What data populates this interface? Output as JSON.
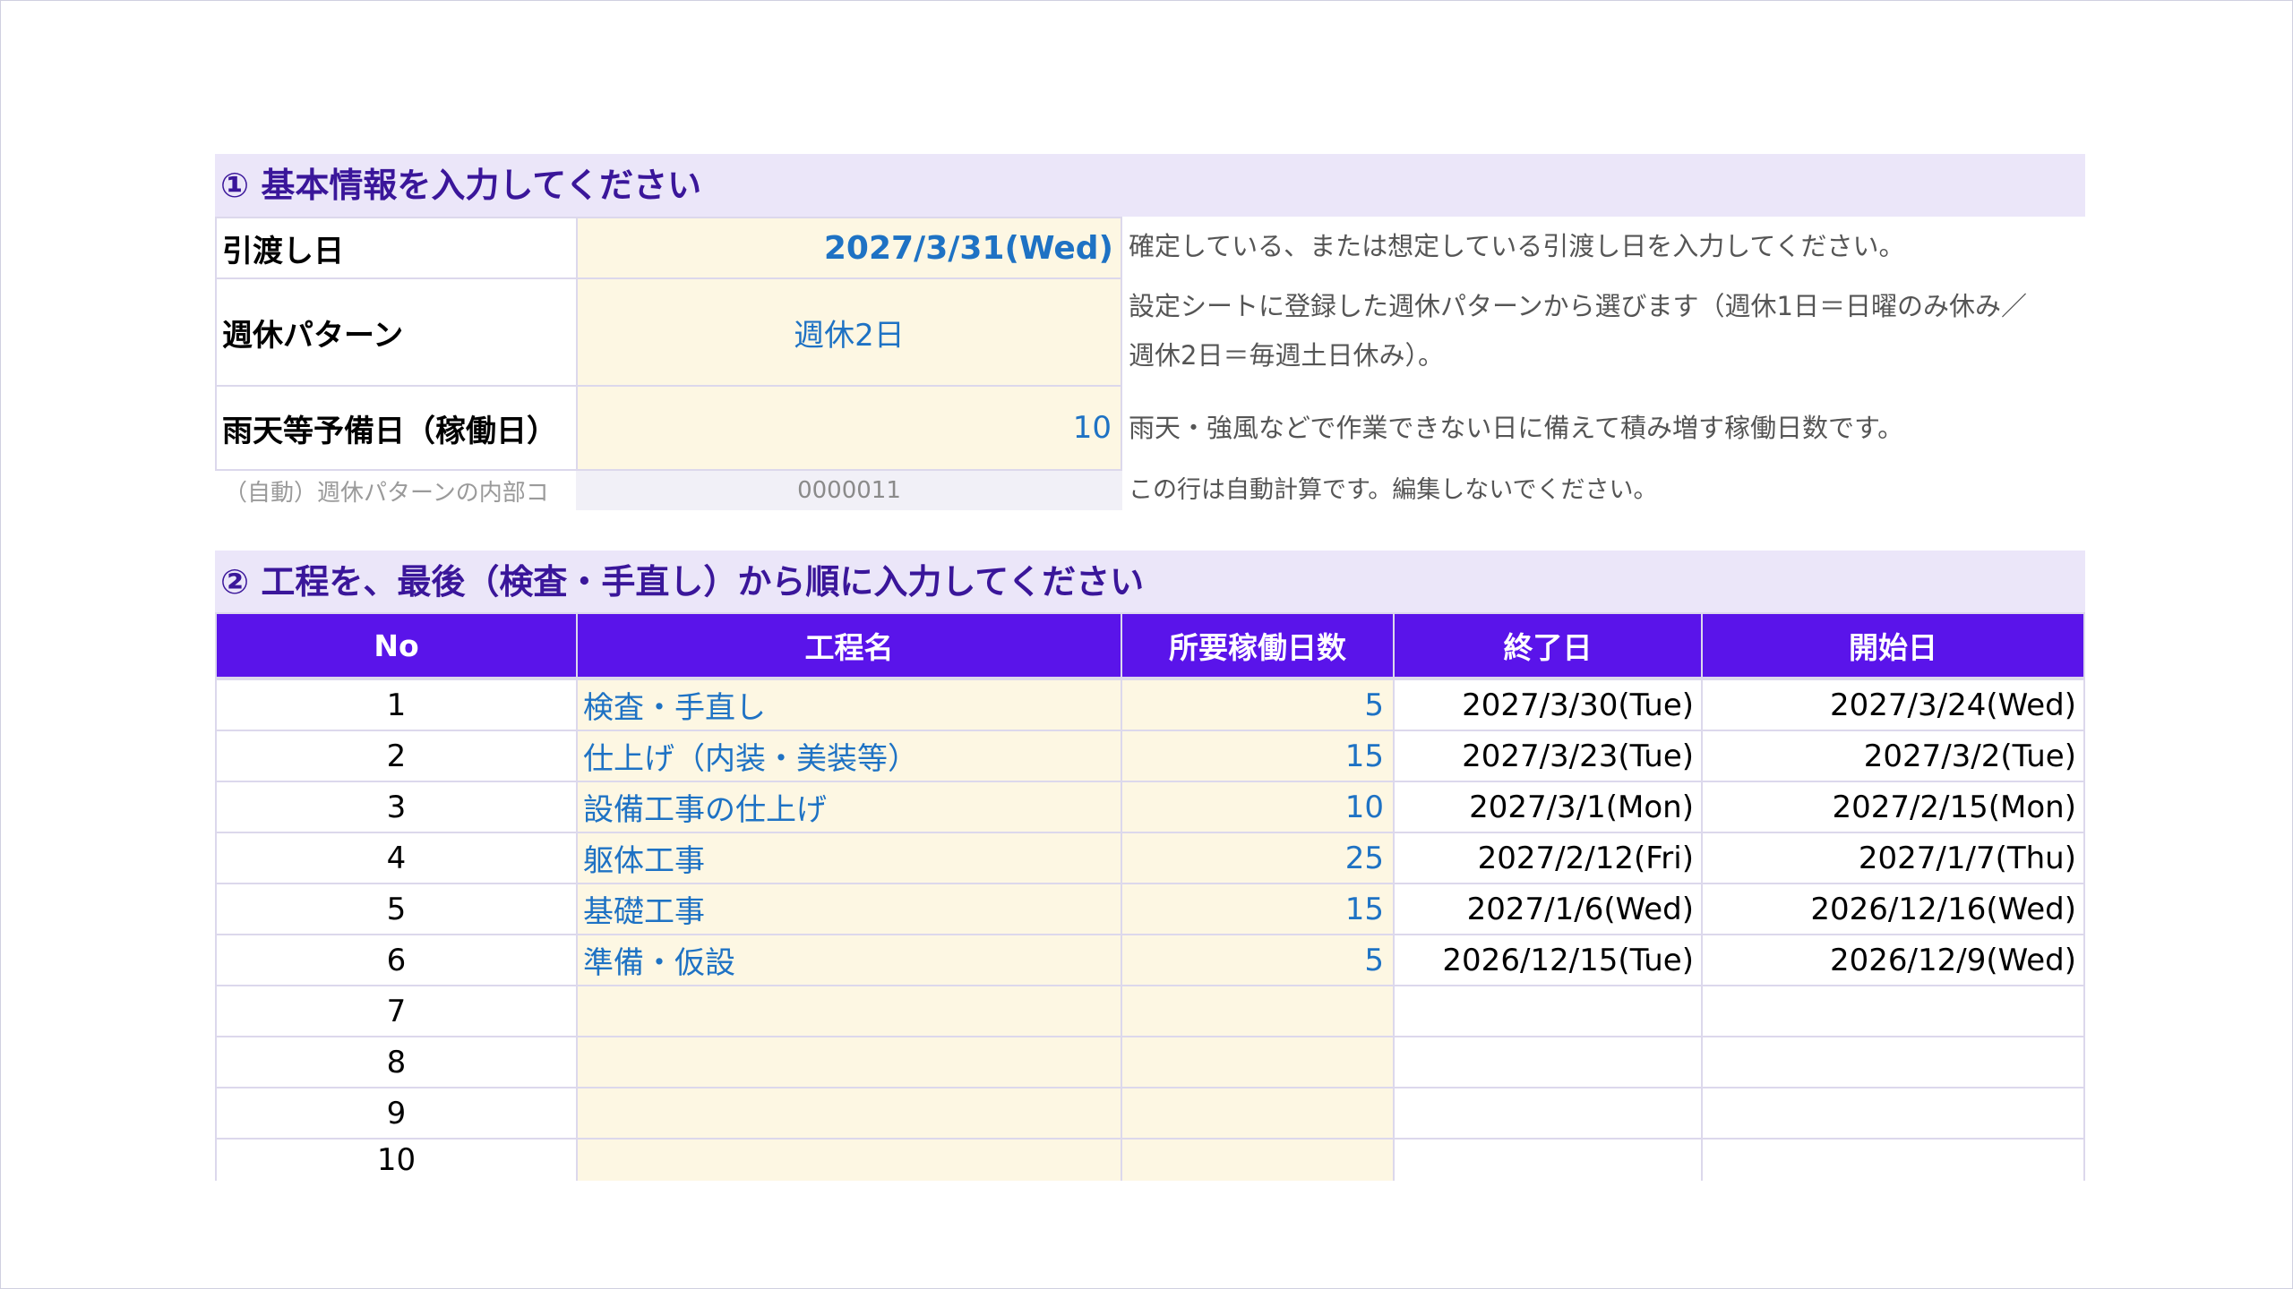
{
  "section1": {
    "title": "① 基本情報を入力してください",
    "rows": [
      {
        "label": "引渡し日",
        "value": "2027/3/31(Wed)",
        "description": "確定している、または想定している引渡し日を入力してください。"
      },
      {
        "label": "週休パターン",
        "value": "週休2日",
        "description_line1": "設定シートに登録した週休パターンから選びます（週休1日＝日曜のみ休み／",
        "description_line2": "週休2日＝毎週土日休み）。"
      },
      {
        "label": "雨天等予備日（稼働日）",
        "value": "10",
        "description": "雨天・強風などで作業できない日に備えて積み増す稼働日数です。"
      }
    ],
    "auto_row": {
      "label": "（自動）週休パターンの内部コ",
      "value": "0000011",
      "description": "この行は自動計算です。編集しないでください。"
    }
  },
  "section2": {
    "title": "② 工程を、最後（検査・手直し）から順に入力してください",
    "columns": [
      "No",
      "工程名",
      "所要稼働日数",
      "終了日",
      "開始日"
    ],
    "rows": [
      {
        "no": "1",
        "name": "検査・手直し",
        "days": "5",
        "end": "2027/3/30(Tue)",
        "start": "2027/3/24(Wed)"
      },
      {
        "no": "2",
        "name": "仕上げ（内装・美装等）",
        "days": "15",
        "end": "2027/3/23(Tue)",
        "start": "2027/3/2(Tue)"
      },
      {
        "no": "3",
        "name": "設備工事の仕上げ",
        "days": "10",
        "end": "2027/3/1(Mon)",
        "start": "2027/2/15(Mon)"
      },
      {
        "no": "4",
        "name": "躯体工事",
        "days": "25",
        "end": "2027/2/12(Fri)",
        "start": "2027/1/7(Thu)"
      },
      {
        "no": "5",
        "name": "基礎工事",
        "days": "15",
        "end": "2027/1/6(Wed)",
        "start": "2026/12/16(Wed)"
      },
      {
        "no": "6",
        "name": "準備・仮設",
        "days": "5",
        "end": "2026/12/15(Tue)",
        "start": "2026/12/9(Wed)"
      },
      {
        "no": "7",
        "name": "",
        "days": "",
        "end": "",
        "start": ""
      },
      {
        "no": "8",
        "name": "",
        "days": "",
        "end": "",
        "start": ""
      },
      {
        "no": "9",
        "name": "",
        "days": "",
        "end": "",
        "start": ""
      },
      {
        "no": "10",
        "name": "",
        "days": "",
        "end": "",
        "start": ""
      }
    ]
  },
  "colors": {
    "header_bg": "#5a14ea",
    "section_bg": "#ebe6f9",
    "section_text": "#3a169a",
    "input_bg": "#fdf7e3",
    "input_text": "#1e72c4"
  }
}
